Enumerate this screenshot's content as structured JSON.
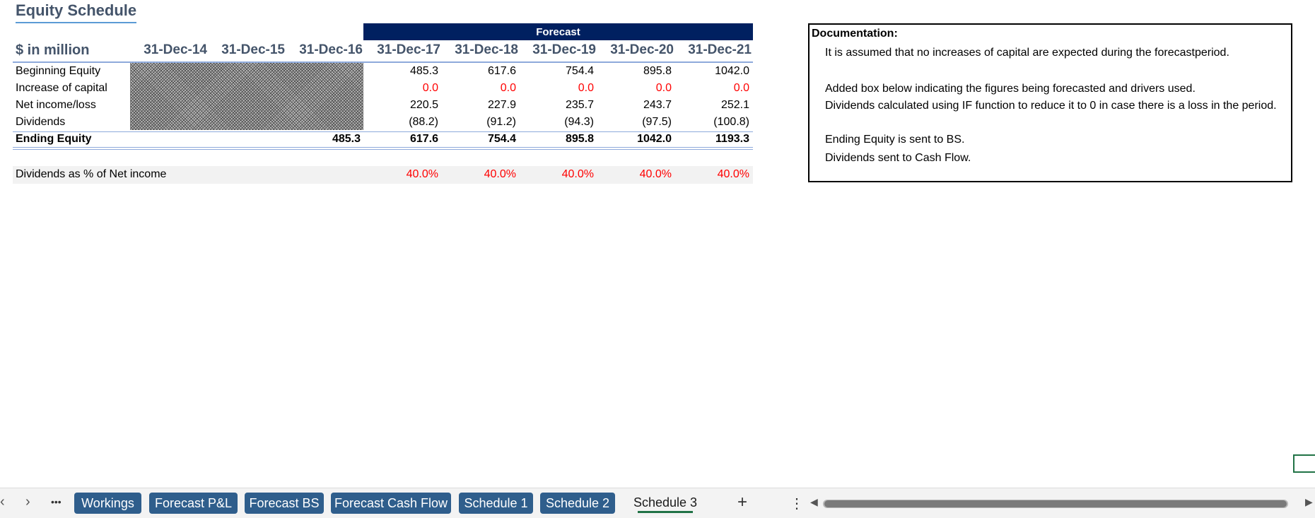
{
  "sheet": {
    "title": "Equity Schedule",
    "forecast_label": "Forecast",
    "units_label": "$ in million",
    "dates": [
      "31-Dec-14",
      "31-Dec-15",
      "31-Dec-16",
      "31-Dec-17",
      "31-Dec-18",
      "31-Dec-19",
      "31-Dec-20",
      "31-Dec-21"
    ],
    "rows": {
      "beginning_equity": {
        "label": "Beginning Equity",
        "values": [
          "485.3",
          "617.6",
          "754.4",
          "895.8",
          "1042.0"
        ]
      },
      "increase_capital": {
        "label": "Increase of capital",
        "values": [
          "0.0",
          "0.0",
          "0.0",
          "0.0",
          "0.0"
        ]
      },
      "net_income": {
        "label": "Net income/loss",
        "values": [
          "220.5",
          "227.9",
          "235.7",
          "243.7",
          "252.1"
        ]
      },
      "dividends": {
        "label": "Dividends",
        "values": [
          "(88.2)",
          "(91.2)",
          "(94.3)",
          "(97.5)",
          "(100.8)"
        ]
      },
      "ending_equity": {
        "label": "Ending Equity",
        "historical": "485.3",
        "values": [
          "617.6",
          "754.4",
          "895.8",
          "1042.0",
          "1193.3"
        ]
      },
      "div_pct": {
        "label": "Dividends as % of Net income",
        "values": [
          "40.0%",
          "40.0%",
          "40.0%",
          "40.0%",
          "40.0%"
        ]
      }
    },
    "input_color": "#FF0000",
    "header_color": "#44546A",
    "forecast_bar_color": "#002060"
  },
  "documentation": {
    "title": "Documentation:",
    "lines": [
      "It is assumed that no increases of capital are expected during the forecastperiod.",
      "Added box below indicating the figures being forecasted and drivers used.",
      "Dividends calculated using IF function to reduce it to 0 in case there is a loss in the period.",
      "Ending Equity is sent to BS.",
      "Dividends sent to Cash Flow."
    ]
  },
  "tabs": {
    "prev_icon": "chevron-left-icon",
    "next_icon": "chevron-right-icon",
    "more": "•••",
    "items": [
      "Workings",
      "Forecast P&L",
      "Forecast BS",
      "Forecast Cash Flow",
      "Schedule 1",
      "Schedule 2"
    ],
    "active": "Schedule 3",
    "add": "+",
    "menu": "⋮",
    "tab_color": "#2F5E8C"
  }
}
